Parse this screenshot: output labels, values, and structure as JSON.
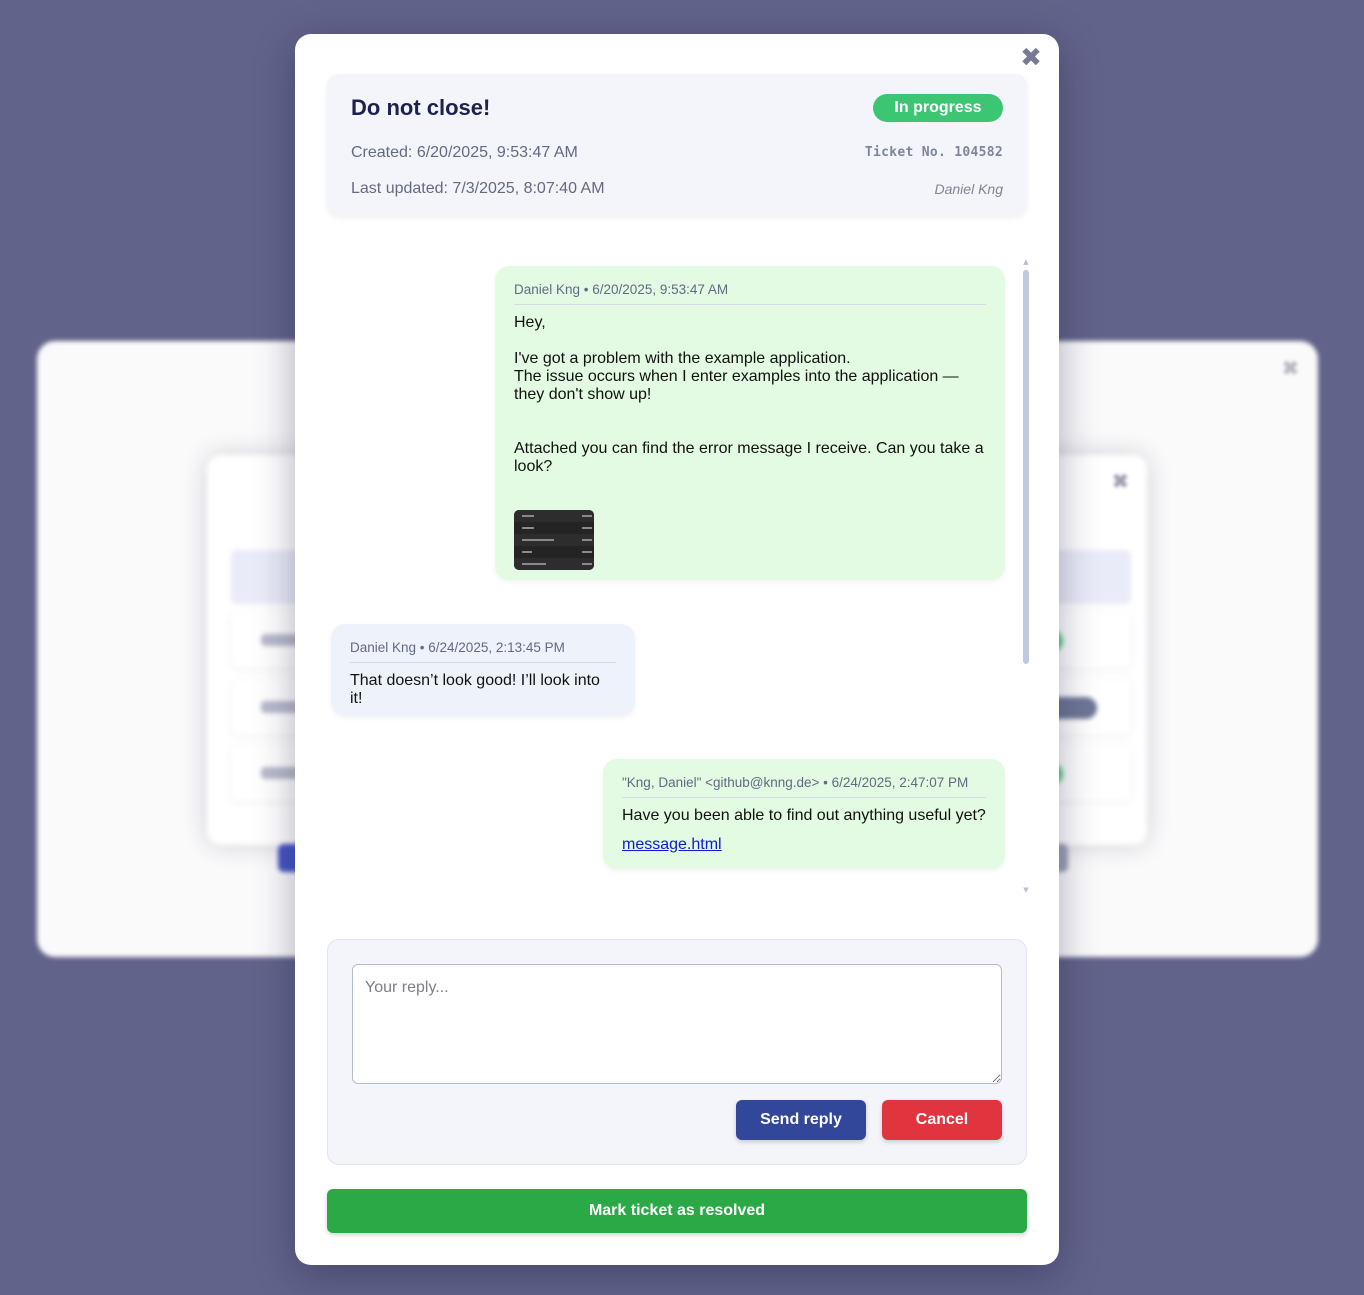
{
  "ticket": {
    "title": "Do not close!",
    "status": "In progress",
    "created": "Created: 6/20/2025, 9:53:47 AM",
    "last_updated": "Last updated: 7/3/2025, 8:07:40 AM",
    "ticket_number": "Ticket No. 104582",
    "owner": "Daniel Kng",
    "close_symbol": "✖"
  },
  "messages": [
    {
      "role": "customer",
      "header": "Daniel Kng • 6/20/2025, 9:53:47 AM",
      "line1": "Hey,",
      "line2": "I've got a problem with the example application.",
      "line3": "The issue occurs when I enter examples into the application — they don't show up!",
      "line4": "Attached you can find the error message I receive. Can you take a look?",
      "attachment": "error-screenshot-thumbnail"
    },
    {
      "role": "agent",
      "header": "Daniel Kng • 6/24/2025, 2:13:45 PM",
      "line1": "That doesn’t look good! I’ll look into it!"
    },
    {
      "role": "customer",
      "header": "\"Kng, Daniel\" <github@knng.de> • 6/24/2025, 2:47:07 PM",
      "line1": "Have you been able to find out anything useful yet?",
      "link": "message.html"
    }
  ],
  "reply": {
    "placeholder": "Your reply...",
    "send_label": "Send reply",
    "cancel_label": "Cancel"
  },
  "resolve_label": "Mark ticket as resolved",
  "colors": {
    "backdrop": "#62638a",
    "status_badge": "#3cc572",
    "customer_bubble": "#e2fbe2",
    "agent_bubble": "#eef3fb",
    "send_button": "#33479a",
    "cancel_button": "#e0353f",
    "resolve_button": "#2aa946"
  },
  "icons": {
    "close": "close-icon",
    "scroll_up": "scroll-up-arrow-icon",
    "scroll_down": "scroll-down-arrow-icon"
  }
}
